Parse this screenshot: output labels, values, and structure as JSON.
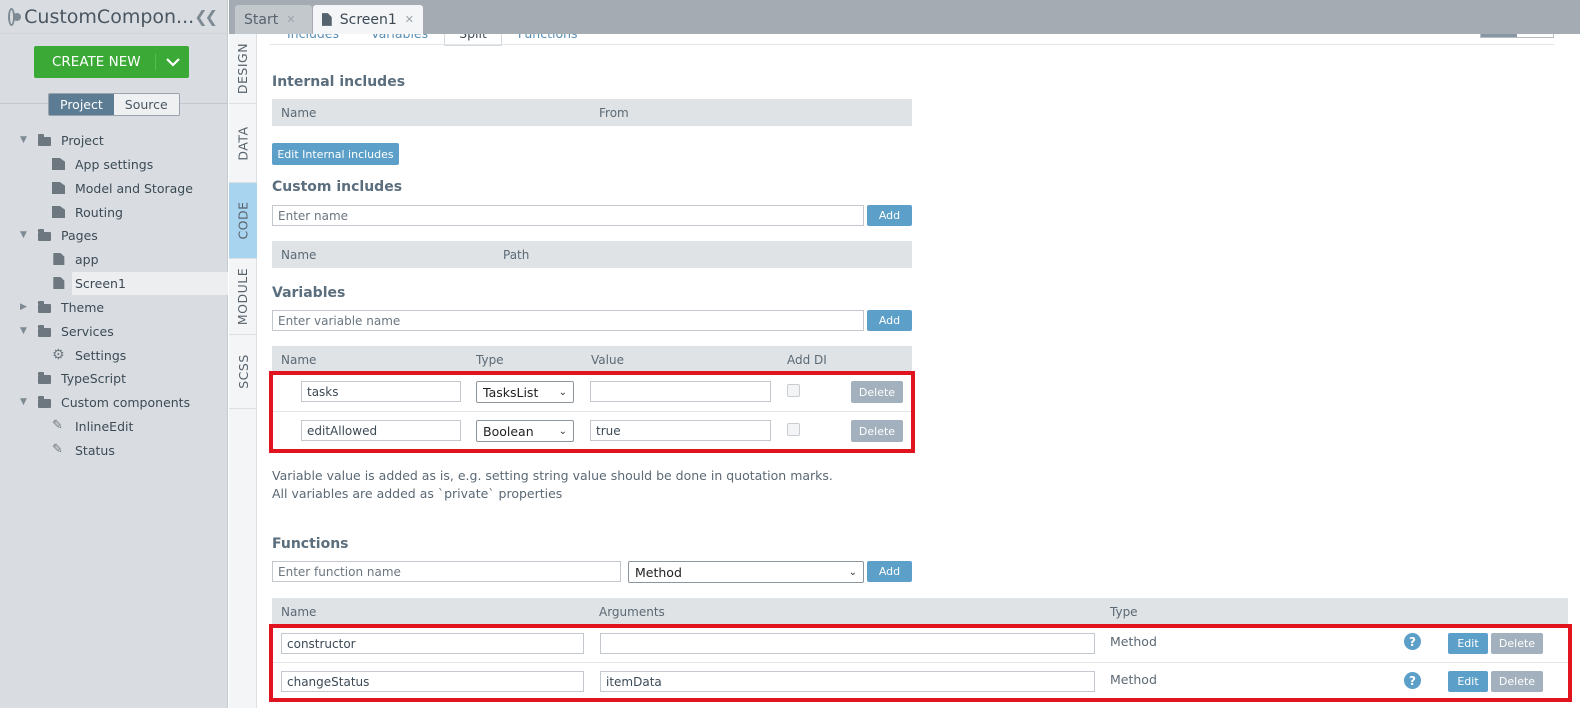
{
  "app": {
    "title": "CustomCompon..."
  },
  "sidebar": {
    "create_label": "CREATE NEW",
    "toggle": {
      "project": "Project",
      "source": "Source"
    },
    "tree": [
      {
        "label": "Project"
      },
      {
        "label": "App settings"
      },
      {
        "label": "Model and Storage"
      },
      {
        "label": "Routing"
      },
      {
        "label": "Pages"
      },
      {
        "label": "app"
      },
      {
        "label": "Screen1"
      },
      {
        "label": "Theme"
      },
      {
        "label": "Services"
      },
      {
        "label": "Settings"
      },
      {
        "label": "TypeScript"
      },
      {
        "label": "Custom components"
      },
      {
        "label": "InlineEdit"
      },
      {
        "label": "Status"
      }
    ]
  },
  "tabs": [
    {
      "label": "Start"
    },
    {
      "label": "Screen1"
    }
  ],
  "side_tabs": [
    "DESIGN",
    "DATA",
    "CODE",
    "MODULE",
    "SCSS"
  ],
  "subtabs": [
    "Includes",
    "Variables",
    "Split",
    "Functions"
  ],
  "internal_includes": {
    "title": "Internal includes",
    "columns": [
      "Name",
      "From"
    ],
    "edit_label": "Edit Internal includes"
  },
  "custom_includes": {
    "title": "Custom includes",
    "placeholder": "Enter name",
    "add_label": "Add",
    "columns": [
      "Name",
      "Path"
    ]
  },
  "variables": {
    "title": "Variables",
    "placeholder": "Enter variable name",
    "add_label": "Add",
    "columns": [
      "Name",
      "Type",
      "Value",
      "Add DI"
    ],
    "rows": [
      {
        "name": "tasks",
        "type": "TasksList",
        "value": "",
        "add_di": false,
        "delete_label": "Delete"
      },
      {
        "name": "editAllowed",
        "type": "Boolean",
        "value": "true",
        "add_di": false,
        "delete_label": "Delete"
      }
    ],
    "note_line1": "Variable value is added as is, e.g. setting string value should be done in quotation marks.",
    "note_line2": "All variables are added as `private` properties"
  },
  "functions": {
    "title": "Functions",
    "placeholder": "Enter function name",
    "type_select": "Method",
    "add_label": "Add",
    "columns": [
      "Name",
      "Arguments",
      "Type"
    ],
    "rows": [
      {
        "name": "constructor",
        "arguments": "",
        "type": "Method",
        "edit_label": "Edit",
        "delete_label": "Delete"
      },
      {
        "name": "changeStatus",
        "arguments": "itemData",
        "type": "Method",
        "edit_label": "Edit",
        "delete_label": "Delete"
      }
    ]
  }
}
